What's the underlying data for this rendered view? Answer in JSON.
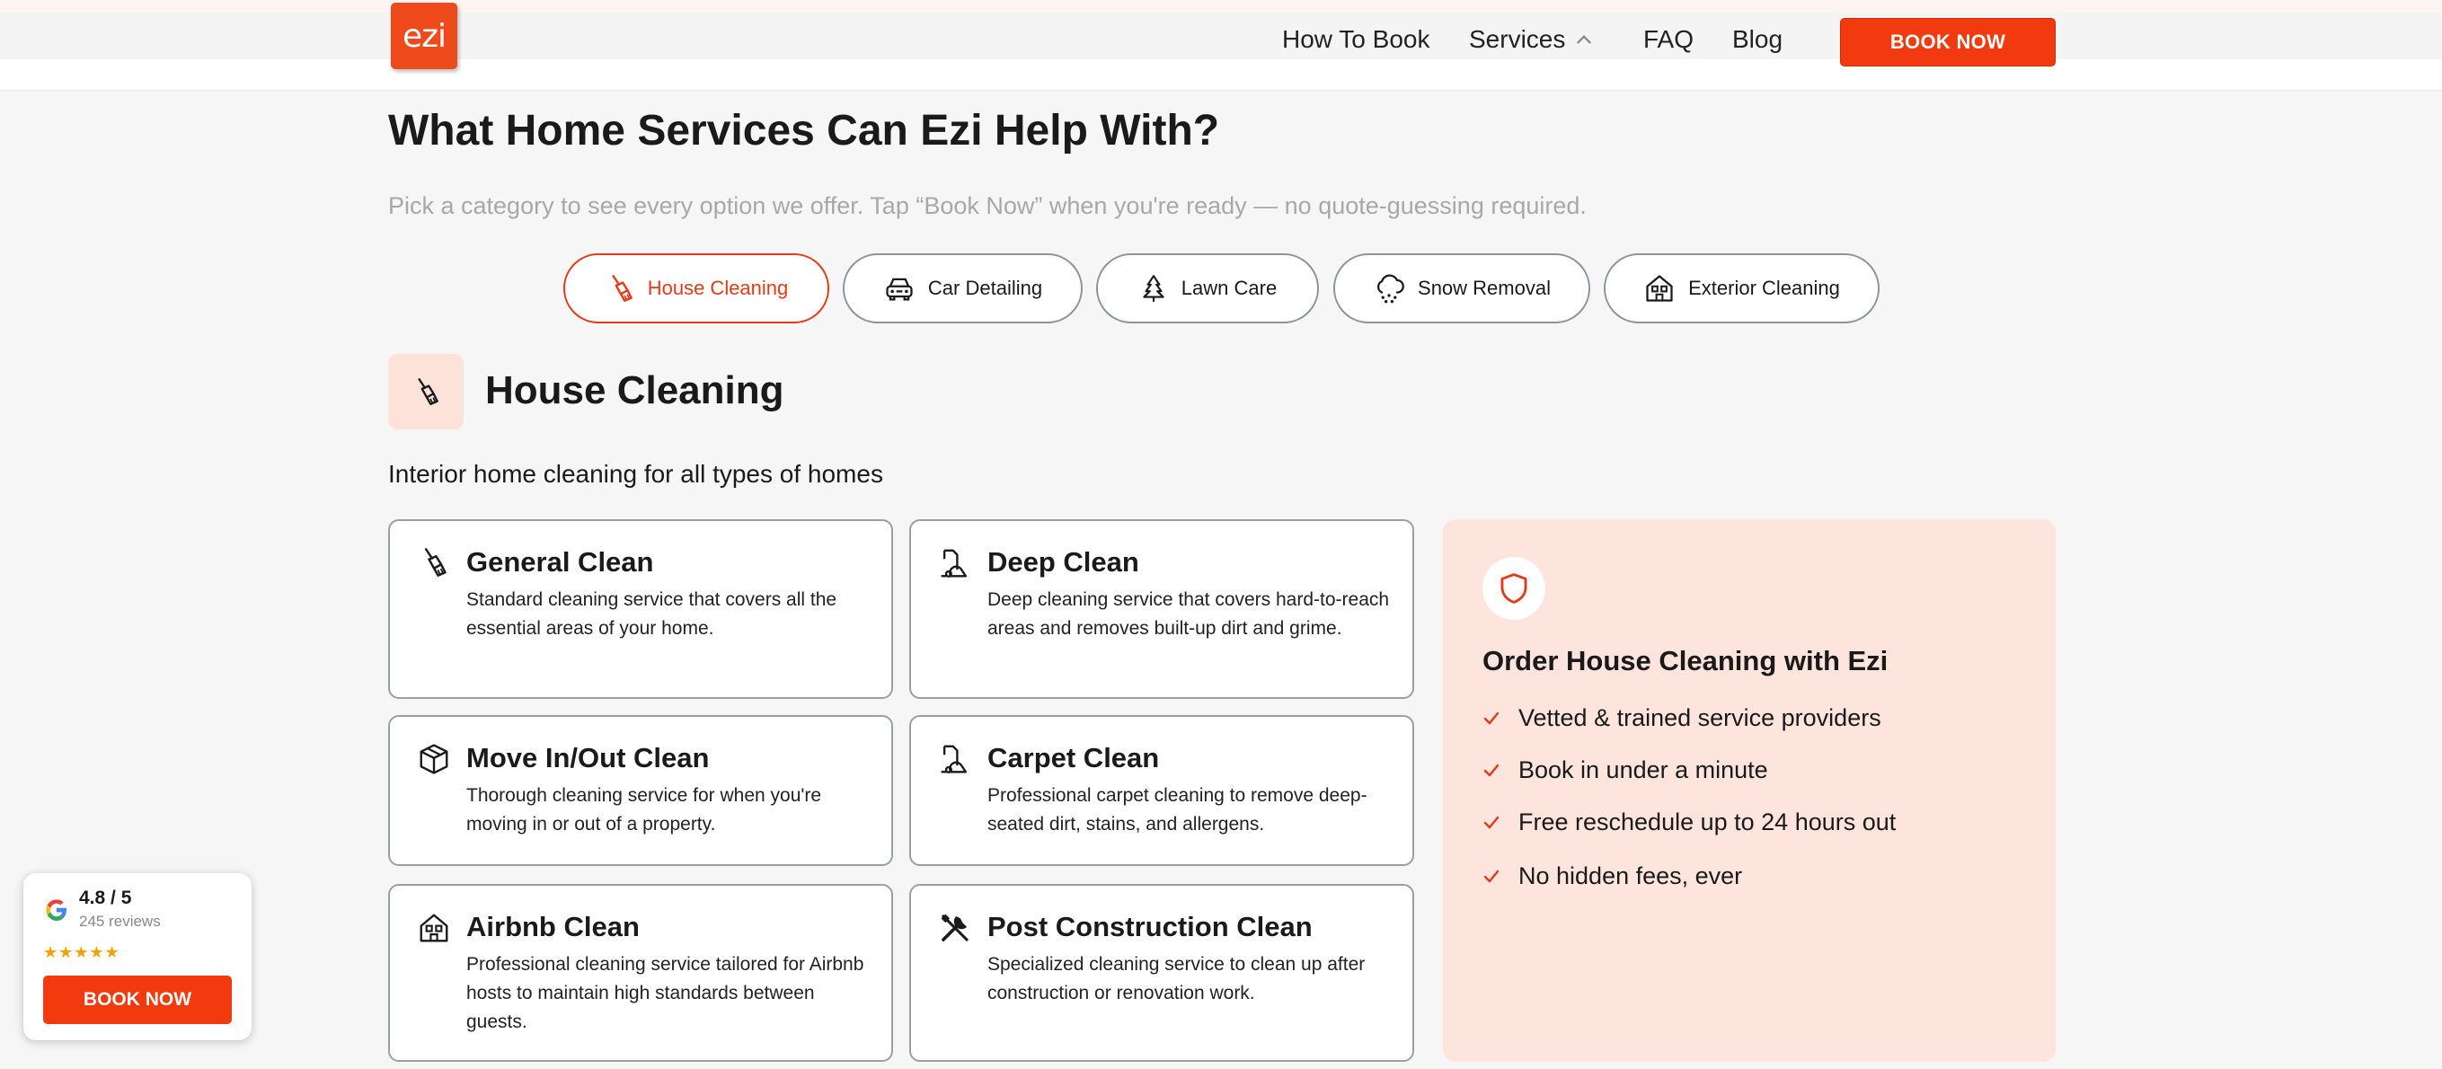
{
  "header": {
    "logo_text": "ezi",
    "nav": [
      {
        "label": "How To Book"
      },
      {
        "label": "Services"
      },
      {
        "label": "FAQ"
      },
      {
        "label": "Blog"
      }
    ],
    "cta_label": "BOOK NOW"
  },
  "main": {
    "title": "What Home Services Can Ezi Help With?",
    "subtitle": "Pick a category to see every option we offer. Tap “Book Now” when you're ready — no quote-guessing required.",
    "tabs": [
      {
        "label": "House Cleaning",
        "icon": "broom-icon",
        "active": true
      },
      {
        "label": "Car Detailing",
        "icon": "car-icon",
        "active": false
      },
      {
        "label": "Lawn Care",
        "icon": "tree-icon",
        "active": false
      },
      {
        "label": "Snow Removal",
        "icon": "snow-cloud-icon",
        "active": false
      },
      {
        "label": "Exterior Cleaning",
        "icon": "house-icon",
        "active": false
      }
    ],
    "section": {
      "title": "House Cleaning",
      "description": "Interior home cleaning for all types of homes",
      "icon": "broom-icon"
    },
    "services": [
      {
        "title": "General Clean",
        "description": "Standard cleaning service that covers all the essential areas of your home.",
        "icon": "broom-icon"
      },
      {
        "title": "Deep Clean",
        "description": "Deep cleaning service that covers hard-to-reach areas and removes built-up dirt and grime.",
        "icon": "vacuum-icon"
      },
      {
        "title": "Move In/Out Clean",
        "description": "Thorough cleaning service for when you're moving in or out of a property.",
        "icon": "box-icon"
      },
      {
        "title": "Carpet Clean",
        "description": "Professional carpet cleaning to remove deep-seated dirt, stains, and allergens.",
        "icon": "vacuum-icon"
      },
      {
        "title": "Airbnb Clean",
        "description": "Professional cleaning service tailored for Airbnb hosts to maintain high standards between guests.",
        "icon": "house-icon"
      },
      {
        "title": "Post Construction Clean",
        "description": "Specialized cleaning service to clean up after construction or renovation work.",
        "icon": "tools-icon"
      }
    ],
    "order_panel": {
      "title": "Order House Cleaning with Ezi",
      "icon": "shield-icon",
      "benefits": [
        "Vetted & trained service providers",
        "Book in under a minute",
        "Free reschedule up to 24 hours out",
        "No hidden fees, ever"
      ]
    }
  },
  "review_widget": {
    "rating": "4.8 / 5",
    "count": "245 reviews",
    "stars": "★★★★★",
    "cta_label": "BOOK NOW"
  },
  "colors": {
    "accent": "#f23a0e",
    "tint": "#fde4dc",
    "background": "#f6f6f6"
  }
}
